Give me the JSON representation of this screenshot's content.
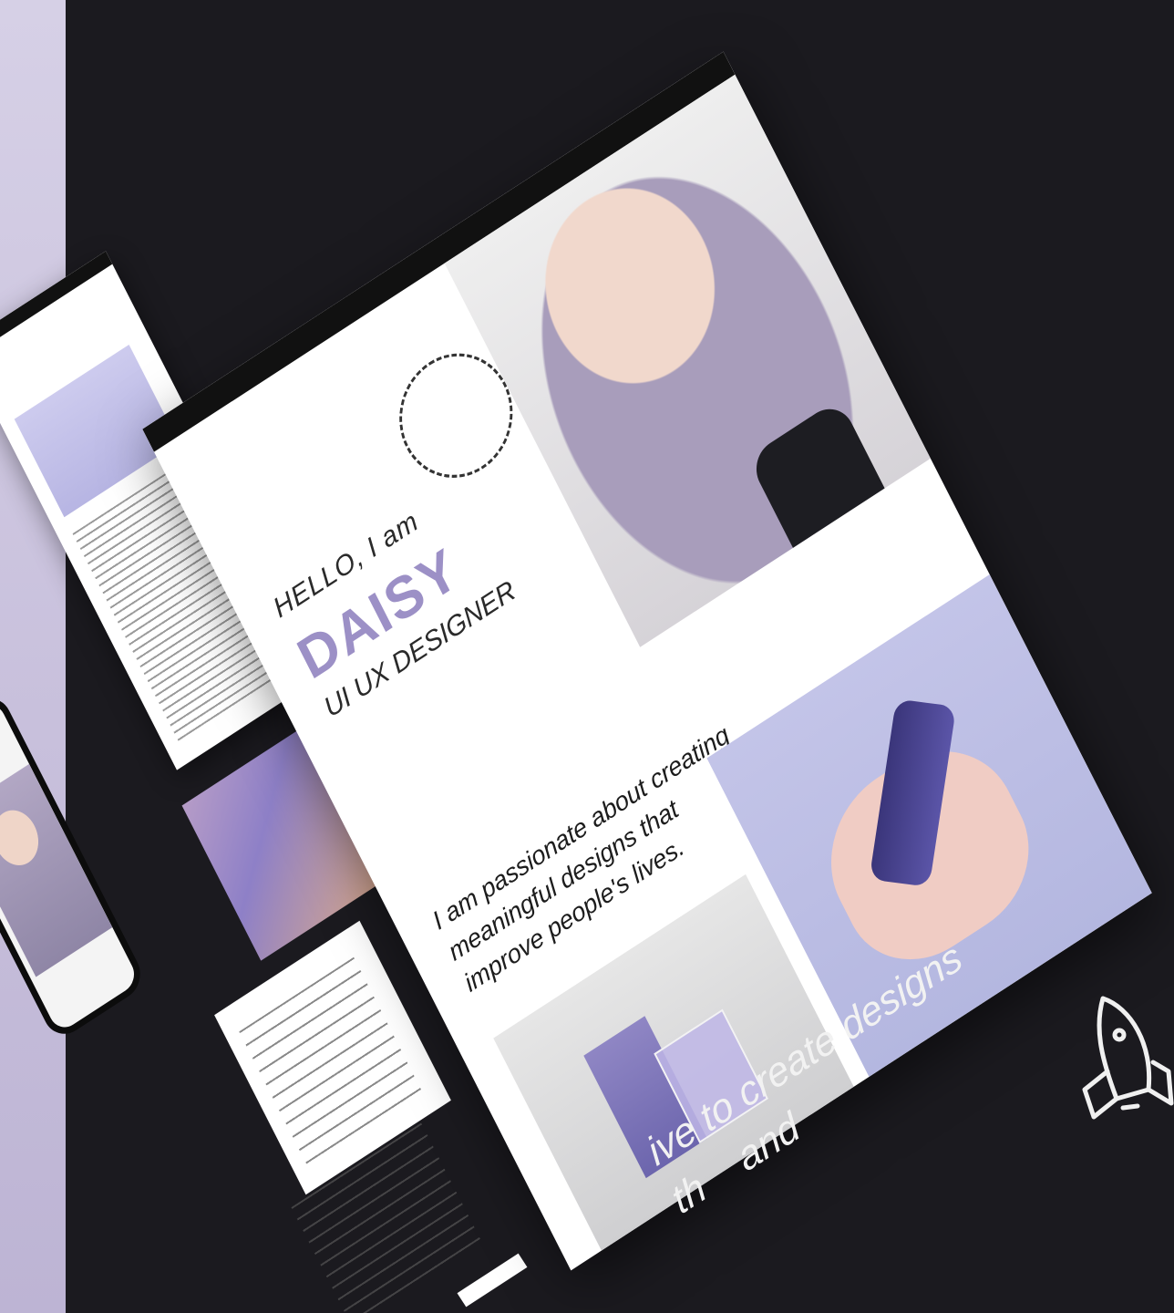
{
  "main": {
    "hello": "HELLO, I am",
    "name": "DAISY",
    "role": "UI UX DESIGNER",
    "passion": "I am passionate about creating meaningful designs that improve people's lives."
  },
  "tagline": "ive to create designs",
  "tagline_fragment": "th    and",
  "colors": {
    "accent": "#9c90c6",
    "background": "#1b1a1f",
    "lavender_strip": "#c8c0dc"
  },
  "icons": [
    "rocket-icon"
  ]
}
